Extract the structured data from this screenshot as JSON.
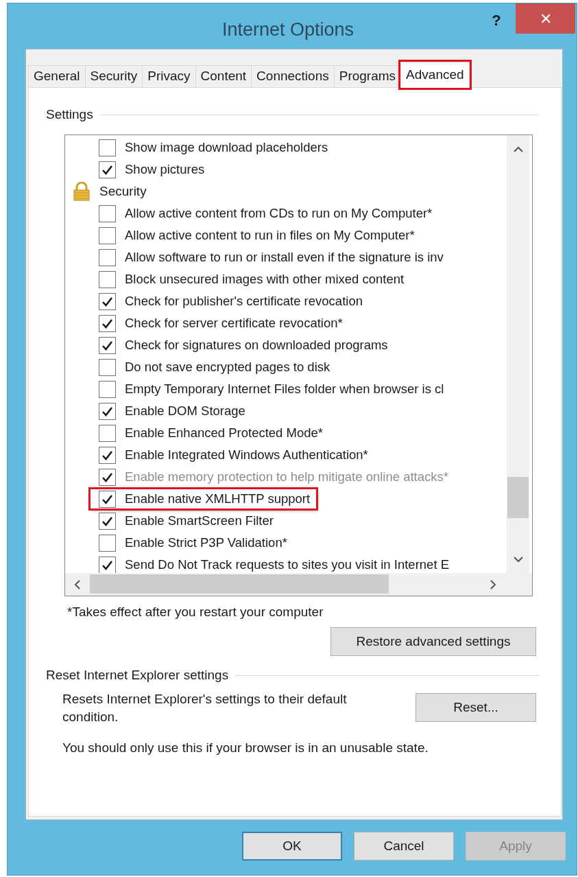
{
  "window": {
    "title": "Internet Options",
    "help": "?",
    "close": "✕"
  },
  "tabs": [
    {
      "label": "General",
      "selected": false,
      "highlighted": false
    },
    {
      "label": "Security",
      "selected": false,
      "highlighted": false
    },
    {
      "label": "Privacy",
      "selected": false,
      "highlighted": false
    },
    {
      "label": "Content",
      "selected": false,
      "highlighted": false
    },
    {
      "label": "Connections",
      "selected": false,
      "highlighted": false
    },
    {
      "label": "Programs",
      "selected": false,
      "highlighted": false
    },
    {
      "label": "Advanced",
      "selected": true,
      "highlighted": true
    }
  ],
  "settings": {
    "title": "Settings",
    "items": [
      {
        "kind": "checkbox",
        "label": "Show image download placeholders",
        "checked": false
      },
      {
        "kind": "checkbox",
        "label": "Show pictures",
        "checked": true
      },
      {
        "kind": "group",
        "label": "Security"
      },
      {
        "kind": "checkbox",
        "label": "Allow active content from CDs to run on My Computer*",
        "checked": false
      },
      {
        "kind": "checkbox",
        "label": "Allow active content to run in files on My Computer*",
        "checked": false
      },
      {
        "kind": "checkbox",
        "label": "Allow software to run or install even if the signature is inv",
        "checked": false
      },
      {
        "kind": "checkbox",
        "label": "Block unsecured images with other mixed content",
        "checked": false
      },
      {
        "kind": "checkbox",
        "label": "Check for publisher's certificate revocation",
        "checked": true
      },
      {
        "kind": "checkbox",
        "label": "Check for server certificate revocation*",
        "checked": true
      },
      {
        "kind": "checkbox",
        "label": "Check for signatures on downloaded programs",
        "checked": true
      },
      {
        "kind": "checkbox",
        "label": "Do not save encrypted pages to disk",
        "checked": false
      },
      {
        "kind": "checkbox",
        "label": "Empty Temporary Internet Files folder when browser is cl",
        "checked": false
      },
      {
        "kind": "checkbox",
        "label": "Enable DOM Storage",
        "checked": true
      },
      {
        "kind": "checkbox",
        "label": "Enable Enhanced Protected Mode*",
        "checked": false
      },
      {
        "kind": "checkbox",
        "label": "Enable Integrated Windows Authentication*",
        "checked": true
      },
      {
        "kind": "checkbox",
        "label": "Enable memory protection to help mitigate online attacks*",
        "checked": true,
        "disabled": true
      },
      {
        "kind": "checkbox",
        "label": "Enable native XMLHTTP support",
        "checked": true,
        "highlighted": true
      },
      {
        "kind": "checkbox",
        "label": "Enable SmartScreen Filter",
        "checked": true
      },
      {
        "kind": "checkbox",
        "label": "Enable Strict P3P Validation*",
        "checked": false
      },
      {
        "kind": "checkbox",
        "label": "Send Do Not Track requests to sites you visit in Internet E",
        "checked": true
      }
    ],
    "note": "*Takes effect after you restart your computer",
    "restore_button": "Restore advanced settings"
  },
  "reset": {
    "title": "Reset Internet Explorer settings",
    "description": "Resets Internet Explorer's settings to their default condition.",
    "button": "Reset...",
    "warning": "You should only use this if your browser is in an unusable state."
  },
  "buttons": [
    {
      "label": "OK",
      "disabled": false,
      "default": true
    },
    {
      "label": "Cancel",
      "disabled": false,
      "default": false
    },
    {
      "label": "Apply",
      "disabled": true,
      "default": false
    }
  ]
}
